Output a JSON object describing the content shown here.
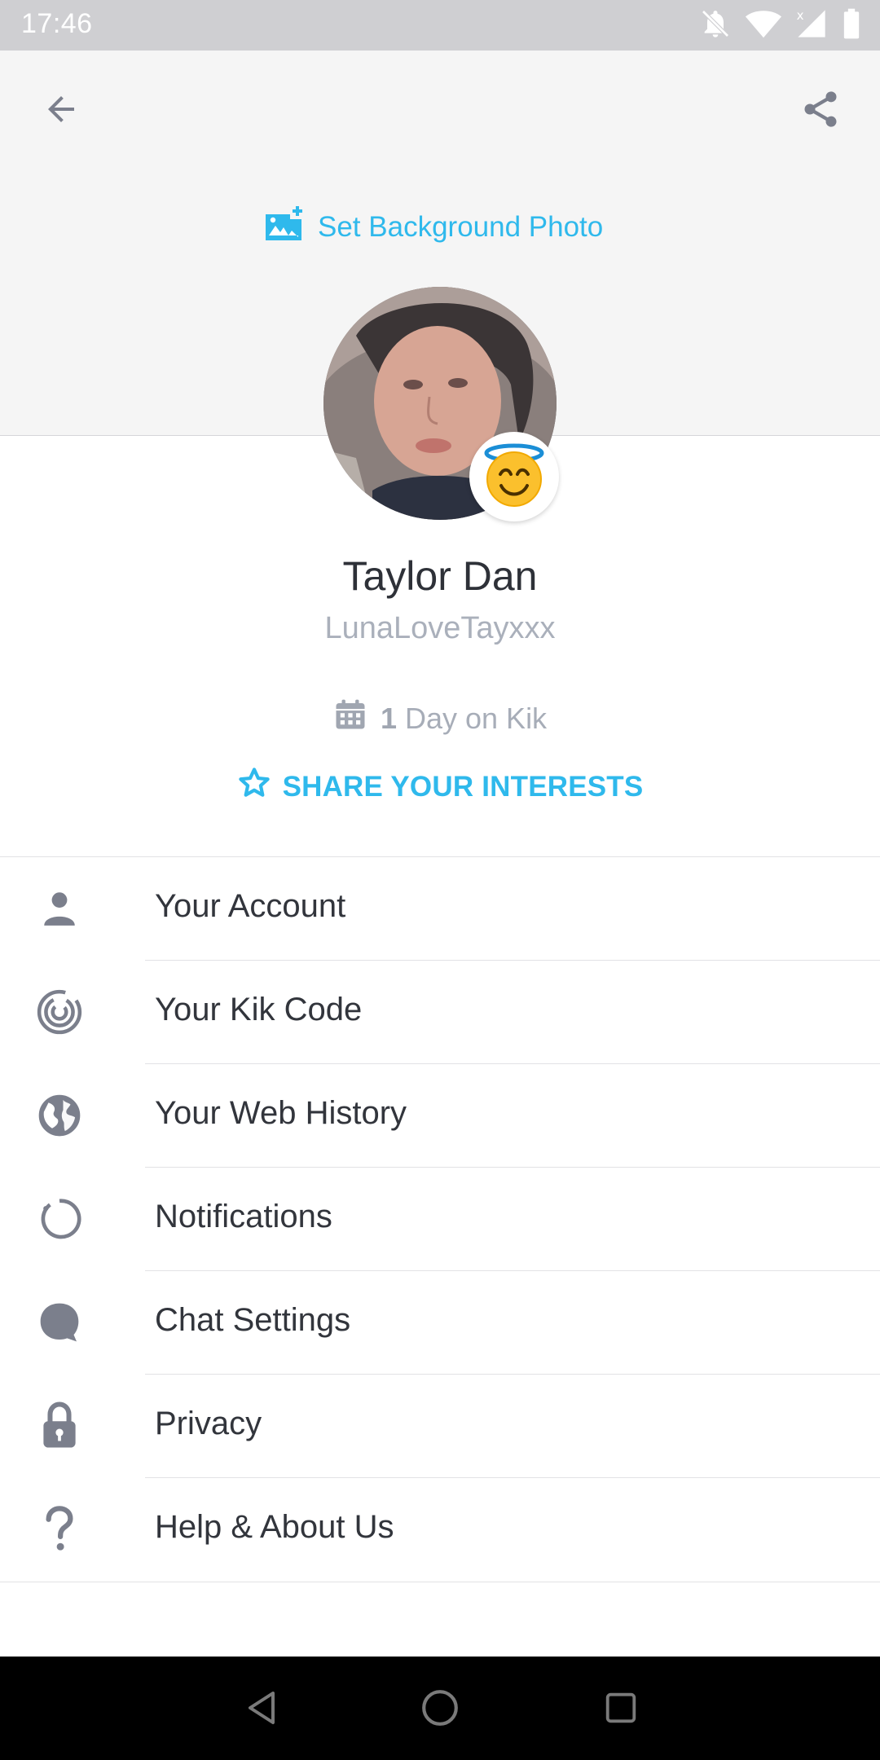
{
  "status_bar": {
    "time": "17:46",
    "icons": [
      "notifications-off-icon",
      "wifi-icon",
      "cellular-icon",
      "battery-icon"
    ]
  },
  "header": {
    "back_icon": "arrow-back-icon",
    "share_icon": "share-icon",
    "set_background_label": "Set Background Photo"
  },
  "profile": {
    "display_name": "Taylor Dan",
    "username": "LunaLoveTayxxx",
    "days_count": "1",
    "days_label": "Day on Kik",
    "share_interests_label": "SHARE YOUR INTERESTS",
    "emoji": "smiling-face-with-halo"
  },
  "menu": {
    "items": [
      {
        "label": "Your Account",
        "icon": "person-icon"
      },
      {
        "label": "Your Kik Code",
        "icon": "kik-code-icon"
      },
      {
        "label": "Your Web History",
        "icon": "globe-icon"
      },
      {
        "label": "Notifications",
        "icon": "notifications-ring-icon"
      },
      {
        "label": "Chat Settings",
        "icon": "chat-bubble-icon"
      },
      {
        "label": "Privacy",
        "icon": "lock-icon"
      },
      {
        "label": "Help & About Us",
        "icon": "help-icon"
      }
    ]
  },
  "nav_bar": {
    "buttons": [
      "back-triangle-icon",
      "home-circle-icon",
      "recents-square-icon"
    ]
  },
  "colors": {
    "accent": "#2fb9ec",
    "status_bar": "#cfcfd2",
    "header_bg": "#f5f5f5",
    "icon_gray": "#7b7f8c",
    "text_dark": "#32353c",
    "text_muted": "#aab0bb"
  }
}
